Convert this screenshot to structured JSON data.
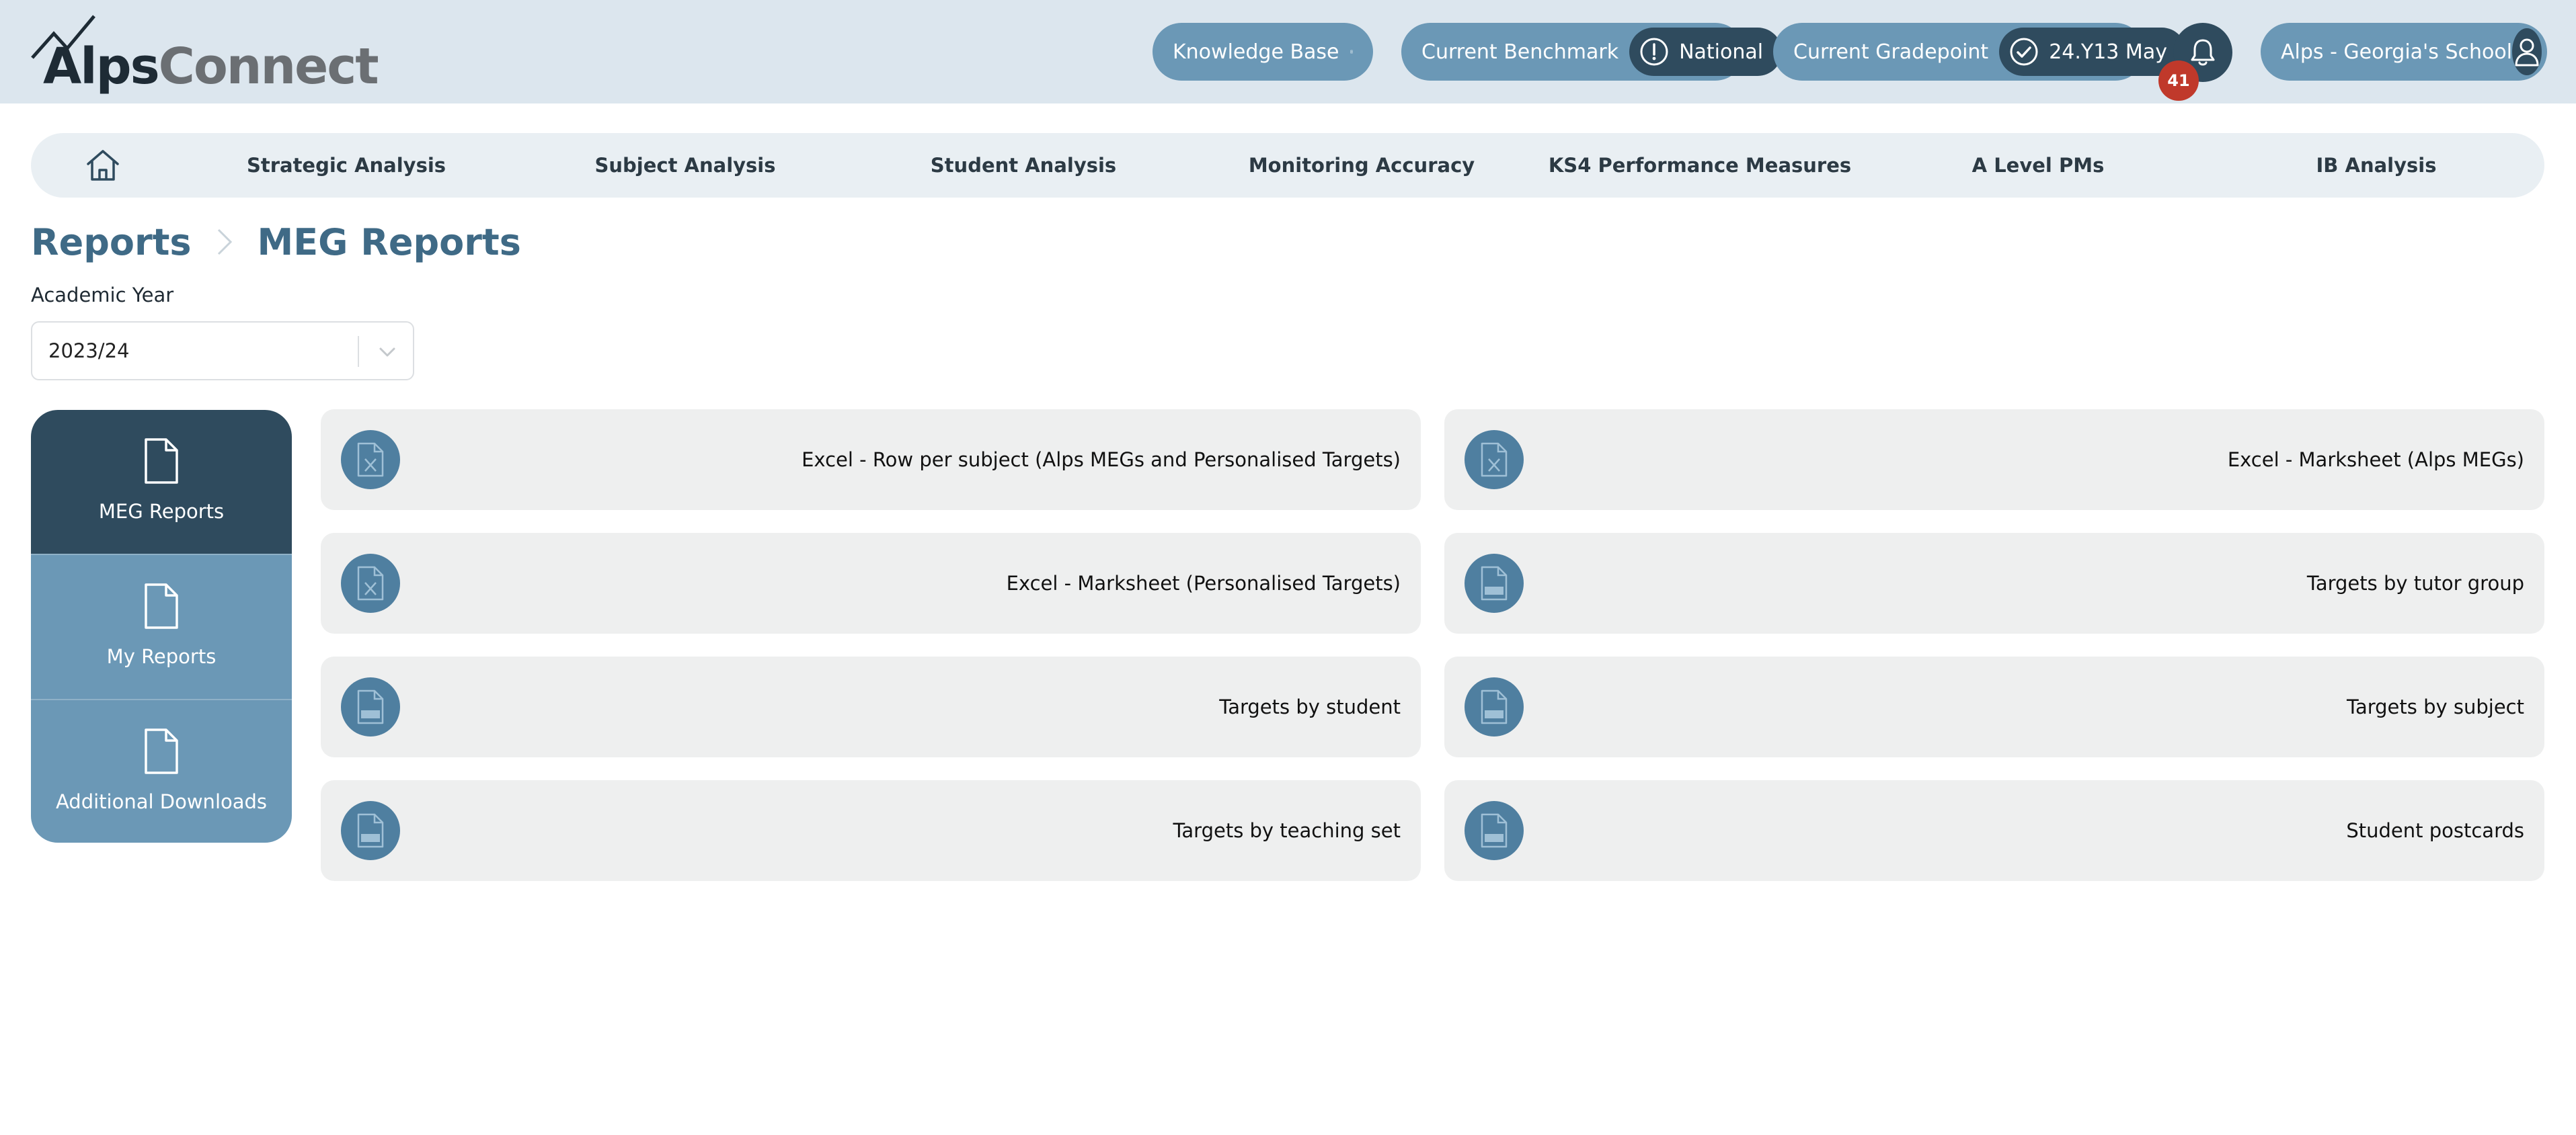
{
  "header": {
    "logo_alps": "Alps",
    "logo_connect": "Connect",
    "knowledge_base_label": "Knowledge Base",
    "benchmark_label": "Current Benchmark",
    "benchmark_value": "National",
    "gradepoint_label": "Current Gradepoint",
    "gradepoint_value": "24.Y13 May",
    "notification_count": "41",
    "user_label": "Alps - Georgia's School"
  },
  "nav": {
    "items": [
      {
        "label": "Strategic Analysis"
      },
      {
        "label": "Subject Analysis"
      },
      {
        "label": "Student Analysis"
      },
      {
        "label": "Monitoring Accuracy"
      },
      {
        "label": "KS4 Performance Measures"
      },
      {
        "label": "A Level PMs"
      },
      {
        "label": "IB Analysis"
      }
    ]
  },
  "breadcrumb": {
    "root": "Reports",
    "current": "MEG Reports"
  },
  "filters": {
    "academic_year_label": "Academic Year",
    "academic_year_value": "2023/24"
  },
  "side_tabs": [
    {
      "label": "MEG Reports",
      "active": true
    },
    {
      "label": "My Reports",
      "active": false
    },
    {
      "label": "Additional Downloads",
      "active": false
    }
  ],
  "reports": [
    {
      "label": "Excel - Row per subject (Alps MEGs and Personalised Targets)",
      "icon": "excel-file-icon"
    },
    {
      "label": "Excel - Marksheet (Alps MEGs)",
      "icon": "excel-file-icon"
    },
    {
      "label": "Excel - Marksheet (Personalised Targets)",
      "icon": "excel-file-icon"
    },
    {
      "label": "Targets by tutor group",
      "icon": "pdf-file-icon"
    },
    {
      "label": "Targets by student",
      "icon": "pdf-file-icon"
    },
    {
      "label": "Targets by subject",
      "icon": "pdf-file-icon"
    },
    {
      "label": "Targets by teaching set",
      "icon": "pdf-file-icon"
    },
    {
      "label": "Student postcards",
      "icon": "pdf-file-icon"
    }
  ],
  "colors": {
    "header_bg": "#dce6ee",
    "pill": "#6b98b6",
    "dark": "#2f4b5e",
    "badge": "#c0392b",
    "card": "#eeefef",
    "breadcrumb": "#3f6a86"
  }
}
